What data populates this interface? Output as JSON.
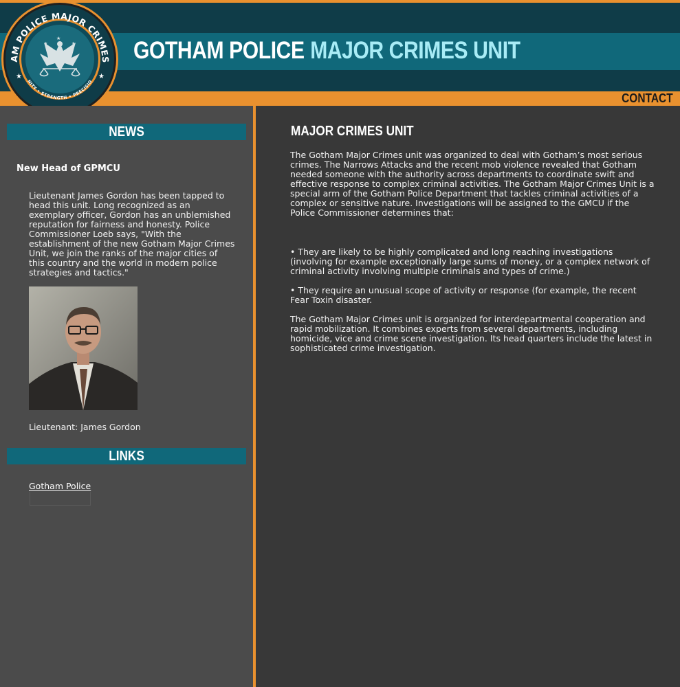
{
  "header": {
    "title_part1": "GOTHAM POLICE",
    "title_part2": "MAJOR CRIMES UNIT",
    "contact_label": "CONTACT",
    "logo": {
      "top_text": "GOTHAM POLICE MAJOR CRIMES UNIT",
      "bottom_text": "UNITY • STRENGTH • PRECISION",
      "icon": "phoenix-scales-emblem"
    }
  },
  "sidebar": {
    "news_heading": "NEWS",
    "news_title": "New Head of GPMCU",
    "news_body": "Lieutenant James Gordon has been tapped to head this unit. Long recognized as an exemplary officer, Gordon has an unblemished reputation for fairness and honesty. Police Commissioner Loeb says, \"With the establishment of the new Gotham Major Crimes Unit, we join the ranks of the major cities of this country and the world in modern police strategies and tactics.\"",
    "photo_caption": "Lieutenant: James Gordon",
    "links_heading": "LINKS",
    "links": [
      "Gotham Police"
    ]
  },
  "main": {
    "title": "MAJOR CRIMES UNIT",
    "paragraph1": "The Gotham Major Crimes unit was organized to deal with Gotham’s most serious crimes. The Narrows Attacks and the recent mob violence revealed that Gotham needed someone with the authority across departments to coordinate swift and effective response to complex criminal activities. The Gotham Major Crimes Unit is a special arm of the Gotham Police Department that tackles criminal activities of a complex or sensitive nature. Investigations will be assigned to the GMCU if the Police Commissioner determines that:",
    "bullets": [
      "•  They are likely to be highly complicated and long reaching investigations (involving for example exceptionally large sums of money, or a complex network of criminal activity involving multiple criminals and types of crime.)",
      "•  They require an unusual scope of activity or response (for example, the recent Fear Toxin disaster."
    ],
    "paragraph2": "The Gotham Major Crimes unit is organized for interdepartmental cooperation and rapid mobilization. It combines experts from several departments, including homicide, vice and crime scene investigation. Its head quarters include the latest in sophisticated crime investigation."
  },
  "colors": {
    "orange": "#e9912f",
    "teal_dark": "#0f3c48",
    "teal": "#10687a",
    "title_accent": "#a8ecf6",
    "sidebar_bg": "#4b4b4b",
    "main_bg": "#383838"
  }
}
